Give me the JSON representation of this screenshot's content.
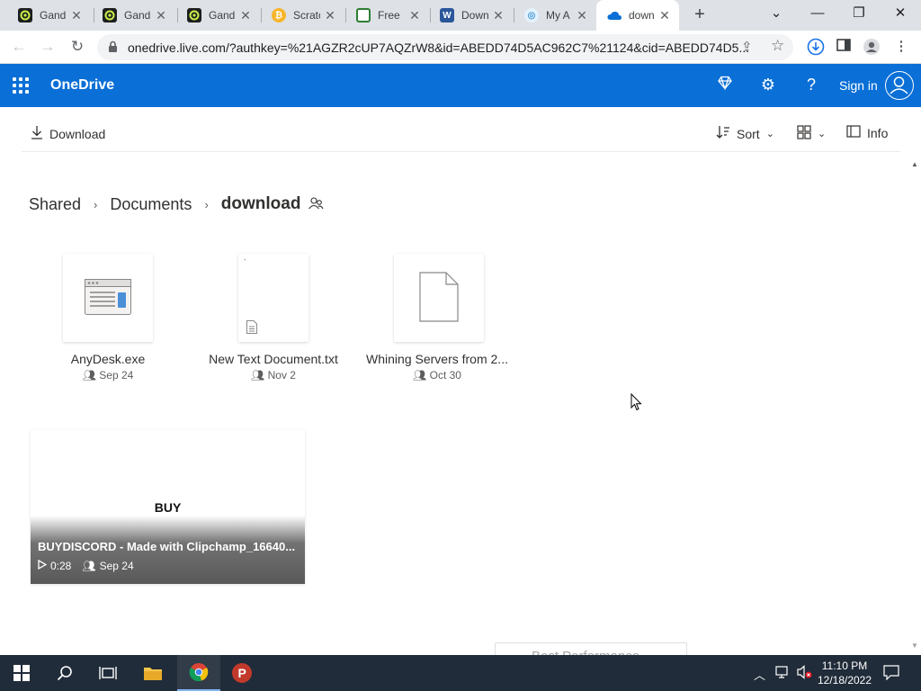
{
  "browser": {
    "tabs": [
      {
        "title": "Gandi",
        "icon": "gandi-icon"
      },
      {
        "title": "Gandi",
        "icon": "gandi-icon"
      },
      {
        "title": "Gandi",
        "icon": "gandi-icon"
      },
      {
        "title": "Scratch",
        "icon": "bitcoin-icon"
      },
      {
        "title": "Free",
        "icon": "sheet-icon"
      },
      {
        "title": "Down",
        "icon": "word-icon"
      },
      {
        "title": "My A",
        "icon": "globe-icon"
      },
      {
        "title": "down",
        "icon": "onedrive-icon",
        "active": true
      }
    ],
    "url": "onedrive.live.com/?authkey=%21AGZR2cUP7AQZrW8&id=ABEDD74D5AC962C7%21124&cid=ABEDD74D5..."
  },
  "header": {
    "app_name": "OneDrive",
    "sign_in": "Sign in",
    "accent": "#0a6fd6"
  },
  "commands": {
    "download": "Download",
    "sort": "Sort",
    "info": "Info"
  },
  "breadcrumb": {
    "items": [
      "Shared",
      "Documents"
    ],
    "current": "download"
  },
  "files": [
    {
      "name": "AnyDesk.exe",
      "date": "Sep 24",
      "kind": "exe"
    },
    {
      "name": "New Text Document.txt",
      "date": "Nov 2",
      "kind": "txt"
    },
    {
      "name": "Whining Servers from 2...",
      "date": "Oct 30",
      "kind": "doc"
    }
  ],
  "video": {
    "thumb_text": "BUY",
    "name": "BUYDISCORD - Made with Clipchamp_16640...",
    "duration": "0:28",
    "date": "Sep 24"
  },
  "overlay_text": "Best Performance",
  "taskbar": {
    "time": "11:10 PM",
    "date": "12/18/2022"
  }
}
